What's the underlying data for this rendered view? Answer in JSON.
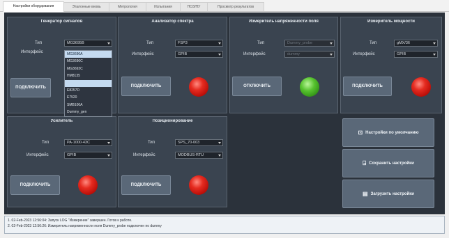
{
  "tabs": [
    "Настройки оборудования",
    "Эталонные вновь",
    "Метрология",
    "Испытания",
    "ПОЗ/ПУ",
    "Просмотр результатов"
  ],
  "labels": {
    "type": "Тип",
    "interface": "Интерфейс",
    "connect": "ПОДКЛЮЧИТЬ",
    "disconnect": "ОТКЛЮЧИТЬ"
  },
  "panels": {
    "generator": {
      "title": "Генератор сигналов",
      "type_value": "MG3695B",
      "interface_value": ""
    },
    "analyzer": {
      "title": "Анализатор спектра",
      "type_value": "FSP3",
      "interface_value": "GPIB"
    },
    "field_meter": {
      "title": "Измеритель напряженности поля",
      "type_value": "Dummy_probe",
      "interface_value": "dummy"
    },
    "power_meter": {
      "title": "Измеритель мощности",
      "type_value": "gMX/36",
      "interface_value": "GPIB"
    },
    "amplifier": {
      "title": "Усилитель",
      "type_value": "PA-1000-43C",
      "interface_value": "GPIB"
    },
    "positioner": {
      "title": "Позиционирование",
      "type_value": "SPS_70-003",
      "interface_value": "MODBUS-RTU"
    }
  },
  "dropdown_options": [
    "MG3690A",
    "MG3690C",
    "MG3692C",
    "HM8135",
    "",
    "E8257D",
    "E7520",
    "SMB100A",
    "Dummy_gen"
  ],
  "dropdown_highlight_indices": [
    0,
    4
  ],
  "actions": {
    "defaults": "Настройки по умолчанию",
    "save": "Сохранить настройки",
    "load": "Загрузить настройки"
  },
  "log": [
    "1. 02-Feb-2023 12:56:04: Запуск LOG \"Измерение\" завершен. Готов к работе.",
    "2. 02-Feb-2023 12:56:26: Измеритель напряженности поля Dummy_probe подключен по dummy"
  ]
}
